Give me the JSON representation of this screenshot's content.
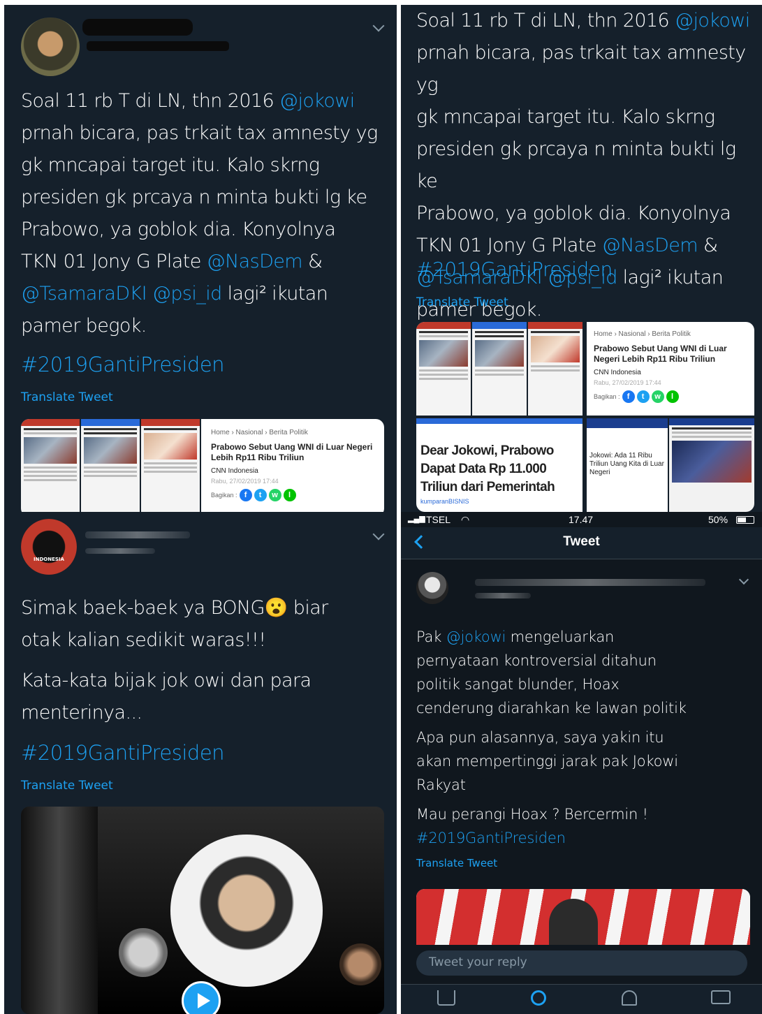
{
  "panel_top_left": {
    "tweet_lines": [
      "Soal 11 rb T di LN, thn 2016 ",
      "prnah bicara, pas trkait tax amnesty yg",
      "gk mncapai target itu. Kalo skrng",
      "presiden gk prcaya n minta bukti lg ke",
      "Prabowo, ya goblok dia. Konyolnya",
      "TKN 01 Jony G Plate ",
      " lagi² ikutan",
      "pamer begok."
    ],
    "mention_jokowi": "@jokowi",
    "mention_nasdem": "@NasDem",
    "amp": " &",
    "mention_tsamara": "@TsamaraDKI",
    "mention_psi": " @psi_id",
    "hashtag": "#2019GantiPresiden",
    "translate": "Translate Tweet"
  },
  "panel_top_right": {
    "translate": "Translate Tweet",
    "card_overlay_1": "Dear Jokowi, Prabowo Dapat Data Rp 11.000 Triliun dari Pemerintah",
    "card_overlay_1_source": "kumparanBISNIS",
    "card_overlay_2": "Jokowi: Ada 11 Ribu Triliun Uang Kita di Luar Negeri"
  },
  "news_card": {
    "crumb": "Home › Nasional › Berita Politik",
    "headline": "Prabowo Sebut Uang WNI di Luar Negeri Lebih Rp11 Ribu Triliun",
    "source": "CNN Indonesia",
    "date": "Rabu, 27/02/2019 17:44",
    "share_label": "Bagikan :",
    "thumb_labels": [
      "detiknews",
      "kumparan",
      "detiknews"
    ]
  },
  "panel_bottom_left": {
    "line1": "Simak baek-baek ya BONG",
    "emoji": "😮",
    "line1_end": " biar",
    "line2": "otak kalian sedikit waras!!!",
    "line3": "Kata-kata bijak jok owi dan para",
    "line4": "menterinya...",
    "hashtag": "#2019GantiPresiden",
    "translate": "Translate Tweet",
    "avatar_label": "INDONESIA"
  },
  "panel_bottom_right": {
    "status": {
      "carrier": "TSEL",
      "time": "17.47",
      "battery": "50%"
    },
    "nav_title": "Tweet",
    "tweet_lines": [
      "Pak ",
      " mengeluarkan",
      "pernyataan kontroversial ditahun",
      "politik  sangat blunder, Hoax",
      "cenderung diarahkan ke lawan politik",
      "Apa pun alasannya, saya yakin itu",
      "akan mempertinggi jarak pak Jokowi",
      "Rakyat",
      "Mau perangi Hoax ? Bercermin !"
    ],
    "mention": "@jokowi",
    "hashtag": "#2019GantiPresiden",
    "translate": "Translate Tweet",
    "reply_placeholder": "Tweet your reply"
  },
  "colors": {
    "background": "#15202b",
    "accent": "#1da1f2",
    "text": "#ffffff"
  }
}
